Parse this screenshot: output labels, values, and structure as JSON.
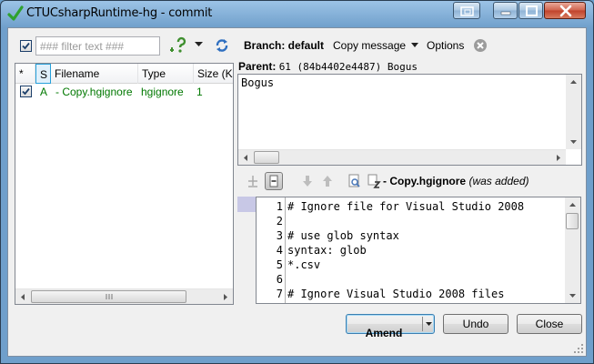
{
  "window": {
    "title": "CTUCsharpRuntime-hg - commit"
  },
  "toolbar": {
    "filter_placeholder": "### filter text ###",
    "filter_value": "",
    "branch_label": "Branch: default",
    "copy_message_label": "Copy message",
    "options_label": "Options"
  },
  "filelist": {
    "columns": [
      "*",
      "S",
      "Filename",
      "Type",
      "Size (KB"
    ],
    "rows": [
      {
        "checked": true,
        "status": "A",
        "filename": "- Copy.hgignore",
        "type": "hgignore",
        "size": "1"
      }
    ]
  },
  "commit": {
    "parent_label": "Parent:",
    "parent_value": "61 (84b4402e4487) Bogus",
    "message": "Bogus"
  },
  "diff": {
    "file_name": "- Copy.hgignore",
    "file_note": "(was added)",
    "lines": [
      {
        "num": "1",
        "text": "# Ignore file for Visual Studio 2008"
      },
      {
        "num": "2",
        "text": ""
      },
      {
        "num": "3",
        "text": "# use glob syntax"
      },
      {
        "num": "4",
        "text": "syntax: glob"
      },
      {
        "num": "5",
        "text": "*.csv"
      },
      {
        "num": "6",
        "text": ""
      },
      {
        "num": "7",
        "text": "# Ignore Visual Studio 2008 files"
      }
    ]
  },
  "buttons": {
    "amend": "Amend",
    "undo": "Undo",
    "close": "Close"
  },
  "colors": {
    "added_file": "#007800",
    "title_gradient": "#9cc3e6"
  },
  "icons": [
    "check-icon",
    "restore-icon",
    "minimize-icon",
    "maximize-icon",
    "close-icon",
    "refresh-icon",
    "question-icon",
    "dropdown-arrow-icon",
    "clear-icon"
  ]
}
